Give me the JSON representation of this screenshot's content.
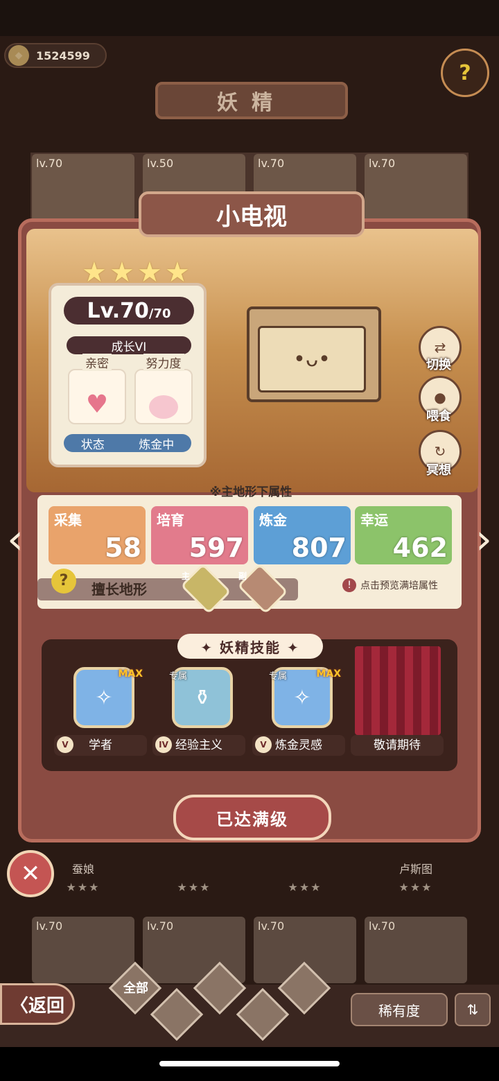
{
  "header": {
    "coins": "1524599",
    "title": "妖精"
  },
  "background_cards": [
    {
      "level": "lv.70"
    },
    {
      "level": "lv.50"
    },
    {
      "level": "lv.70"
    },
    {
      "level": "lv.70"
    }
  ],
  "fairy": {
    "name": "小电视",
    "stars": "★★★★",
    "level": "Lv.70",
    "level_max": "/70",
    "growth": "成长VI",
    "intimacy_label": "亲密",
    "effort_label": "努力度",
    "status_label": "状态",
    "status_value": "炼金中",
    "face": "•ᴗ•"
  },
  "side_actions": [
    {
      "label": "切换"
    },
    {
      "label": "喂食"
    },
    {
      "label": "冥想"
    }
  ],
  "attributes": {
    "title": "※主地形下属性",
    "items": [
      {
        "name": "采集",
        "value": "58",
        "color": "#e9a36b"
      },
      {
        "name": "培育",
        "value": "597",
        "color": "#e27b8c"
      },
      {
        "name": "炼金",
        "value": "807",
        "color": "#5d9fd6"
      },
      {
        "name": "幸运",
        "value": "462",
        "color": "#8cc36a"
      }
    ],
    "terrain_label": "擅长地形",
    "terrain_main": "主",
    "terrain_sub": "副",
    "preview_text": "点击预览满培属性"
  },
  "skills": {
    "title": "✦ 妖精技能 ✦",
    "items": [
      {
        "label": "学者",
        "tier": "V",
        "tag": "",
        "max": "MAX"
      },
      {
        "label": "经验主义",
        "tier": "IV",
        "tag": "专属",
        "max": ""
      },
      {
        "label": "炼金灵感",
        "tier": "V",
        "tag": "专属",
        "max": "MAX"
      },
      {
        "label": "敬请期待",
        "tier": "",
        "tag": "",
        "max": ""
      }
    ]
  },
  "maxed_button": "已达满级",
  "underlying_cards": {
    "names": [
      "蚕娘",
      "",
      "",
      "卢斯图"
    ],
    "stars": "★★★",
    "levels": [
      "lv.70",
      "lv.70",
      "lv.70",
      "lv.70"
    ]
  },
  "bottom": {
    "back": "〈返回",
    "filter_all": "全部",
    "rarity": "稀有度",
    "sort_icon": "sort-icon"
  }
}
